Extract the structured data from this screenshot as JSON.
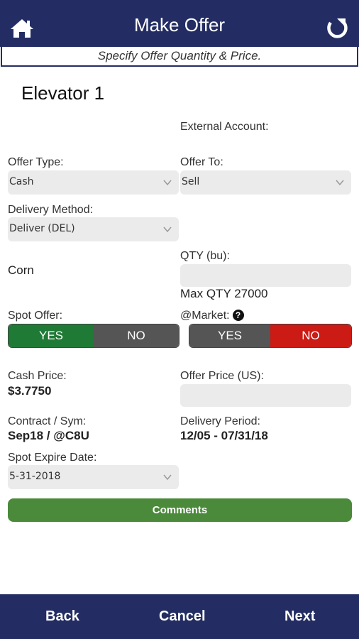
{
  "header": {
    "title": "Make Offer",
    "subtitle": "Specify Offer Quantity & Price.",
    "home_icon": "home-icon",
    "refresh_icon": "refresh-icon",
    "color": "#232d63"
  },
  "page": {
    "title": "Elevator 1"
  },
  "form": {
    "external_account_label": "External Account:",
    "offer_type": {
      "label": "Offer Type:",
      "value": "Cash"
    },
    "offer_to": {
      "label": "Offer To:",
      "value": "Sell"
    },
    "delivery_method": {
      "label": "Delivery Method:",
      "value": "Deliver (DEL)"
    },
    "commodity": "Corn",
    "qty": {
      "label": "QTY (bu):",
      "value": "",
      "max_text": "Max QTY 27000"
    },
    "spot_offer": {
      "label": "Spot Offer:",
      "yes": "YES",
      "no": "NO",
      "selected": "YES"
    },
    "at_market": {
      "label": "@Market:",
      "help_icon": "question-circle-icon",
      "yes": "YES",
      "no": "NO",
      "selected": "NO"
    },
    "cash_price": {
      "label": "Cash Price:",
      "value": "$3.7750"
    },
    "offer_price": {
      "label": "Offer Price (US):",
      "value": ""
    },
    "contract": {
      "label": "Contract / Sym:",
      "value": "Sep18 / @C8U"
    },
    "delivery_period": {
      "label": "Delivery Period:",
      "value": "12/05 - 07/31/18"
    },
    "spot_expire": {
      "label": "Spot Expire Date:",
      "value": "5-31-2018"
    },
    "comments_label": "Comments"
  },
  "footer": {
    "back": "Back",
    "cancel": "Cancel",
    "next": "Next"
  },
  "colors": {
    "yes_active": "#1f7a35",
    "no_active": "#cc1a14",
    "inactive": "#555555",
    "comments": "#4a8a3a"
  }
}
